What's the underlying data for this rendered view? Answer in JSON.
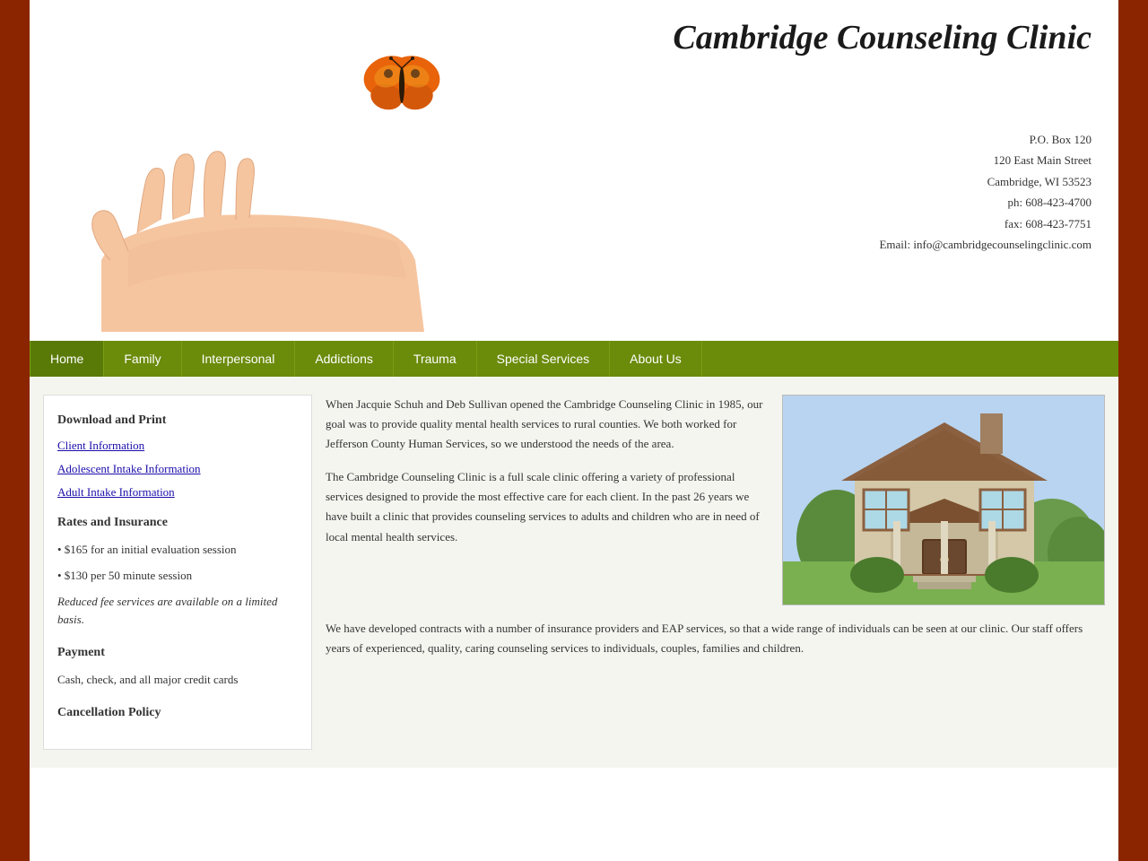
{
  "header": {
    "clinic_title": "Cambridge Counseling Clinic",
    "address_line1": "P.O. Box 120",
    "address_line2": "120 East Main Street",
    "address_line3": "Cambridge, WI 53523",
    "phone": "ph: 608-423-4700",
    "fax": "fax: 608-423-7751",
    "email_label": "Email: info@cambridgecounselingclinic.com"
  },
  "nav": {
    "items": [
      {
        "label": "Home",
        "active": true
      },
      {
        "label": "Family"
      },
      {
        "label": "Interpersonal"
      },
      {
        "label": "Addictions"
      },
      {
        "label": "Trauma"
      },
      {
        "label": "Special Services"
      },
      {
        "label": "About Us"
      }
    ]
  },
  "sidebar": {
    "download_title": "Download and Print",
    "links": [
      {
        "label": "Client Information",
        "href": "#"
      },
      {
        "label": "Adolescent Intake Information",
        "href": "#"
      },
      {
        "label": "Adult Intake Information",
        "href": "#"
      }
    ],
    "rates_title": "Rates and Insurance",
    "rate1": "• $165 for an initial evaluation session",
    "rate2": "• $130 per 50 minute session",
    "reduced_fee": "Reduced fee services are available on a limited basis.",
    "payment_title": "Payment",
    "payment_text": "Cash, check, and all major credit cards",
    "cancellation_title": "Cancellation Policy"
  },
  "content": {
    "para1": "When Jacquie Schuh and Deb Sullivan opened the Cambridge Counseling Clinic in 1985, our goal was to provide quality mental health services to rural counties. We both worked for Jefferson County Human Services, so we understood the needs of the area.",
    "para2": "The Cambridge Counseling Clinic is a full scale clinic offering a variety of professional services designed to provide the most effective care for each client. In the past 26 years we have built a clinic that provides counseling services to adults and children who are in need of local mental health services.",
    "para3": "We have developed contracts with a number of insurance providers and EAP services, so that a wide range of individuals can be seen at our clinic. Our staff offers years of experienced, quality, caring counseling services to individuals, couples, families and children."
  }
}
